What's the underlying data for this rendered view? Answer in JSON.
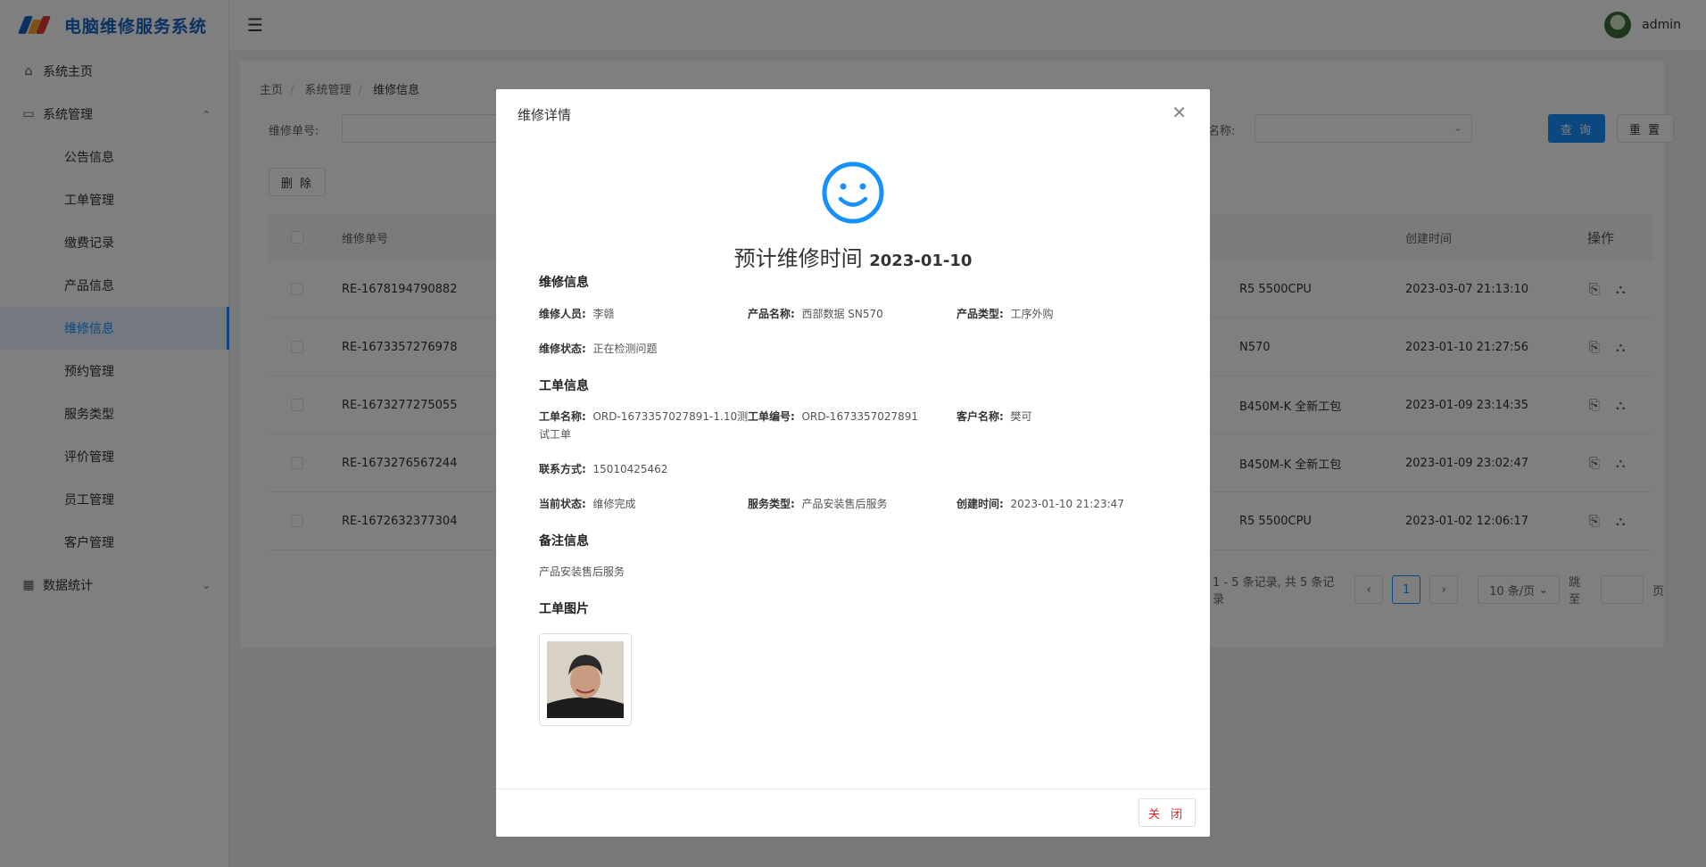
{
  "app": {
    "title": "电脑维修服务系统"
  },
  "header": {
    "username": "admin"
  },
  "sidebar": {
    "items": [
      {
        "label": "系统主页",
        "icon": "home-icon"
      },
      {
        "label": "系统管理",
        "icon": "settings-icon",
        "expanded": true
      },
      {
        "label": "公告信息"
      },
      {
        "label": "工单管理"
      },
      {
        "label": "缴费记录"
      },
      {
        "label": "产品信息"
      },
      {
        "label": "维修信息",
        "active": true
      },
      {
        "label": "预约管理"
      },
      {
        "label": "服务类型"
      },
      {
        "label": "评价管理"
      },
      {
        "label": "员工管理"
      },
      {
        "label": "客户管理"
      },
      {
        "label": "数据统计",
        "icon": "chart-icon"
      }
    ]
  },
  "breadcrumb": [
    "主页",
    "系统管理",
    "维修信息"
  ],
  "search": {
    "repair_no_label": "维修单号:",
    "name_label": "名称:",
    "query_btn": "查 询",
    "reset_btn": "重 置"
  },
  "toolbar": {
    "delete_btn": "删 除"
  },
  "table": {
    "headers": {
      "no": "维修单号",
      "created": "创建时间",
      "op": "操作"
    },
    "rows": [
      {
        "no": "RE-1678194790882",
        "product": "R5 5500CPU",
        "created": "2023-03-07 21:13:10"
      },
      {
        "no": "RE-1673357276978",
        "product": "N570",
        "created": "2023-01-10 21:27:56"
      },
      {
        "no": "RE-1673277275055",
        "product": "B450M-K 全新工包",
        "created": "2023-01-09 23:14:35"
      },
      {
        "no": "RE-1673276567244",
        "product": "B450M-K 全新工包",
        "created": "2023-01-09 23:02:47"
      },
      {
        "no": "RE-1672632377304",
        "product": "R5 5500CPU",
        "created": "2023-01-02 12:06:17"
      }
    ]
  },
  "pager": {
    "summary": "1 - 5 条记录, 共 5 条记录",
    "current": "1",
    "page_size": "10 条/页",
    "jump_label": "跳至",
    "page_suffix": "页"
  },
  "modal": {
    "title": "维修详情",
    "estimate_label": "预计维修时间",
    "estimate_date": "2023-01-10",
    "sections": {
      "repair": "维修信息",
      "order": "工单信息",
      "remark": "备注信息",
      "image": "工单图片"
    },
    "repair": {
      "staff_label": "维修人员:",
      "staff": "李赣",
      "product_name_label": "产品名称:",
      "product_name": "西部数据 SN570",
      "product_type_label": "产品类型:",
      "product_type": "工序外购",
      "status_label": "维修状态:",
      "status": "正在检测问题"
    },
    "order": {
      "name_label": "工单名称:",
      "name": "ORD-1673357027891-1.10测试工单",
      "code_label": "工单编号:",
      "code": "ORD-1673357027891",
      "customer_label": "客户名称:",
      "customer": "樊可",
      "contact_label": "联系方式:",
      "contact": "15010425462",
      "state_label": "当前状态:",
      "state": "维修完成",
      "service_label": "服务类型:",
      "service": "产品安装售后服务",
      "created_label": "创建时间:",
      "created": "2023-01-10 21:23:47"
    },
    "remark": "产品安装售后服务",
    "close_btn": "关 闭"
  }
}
